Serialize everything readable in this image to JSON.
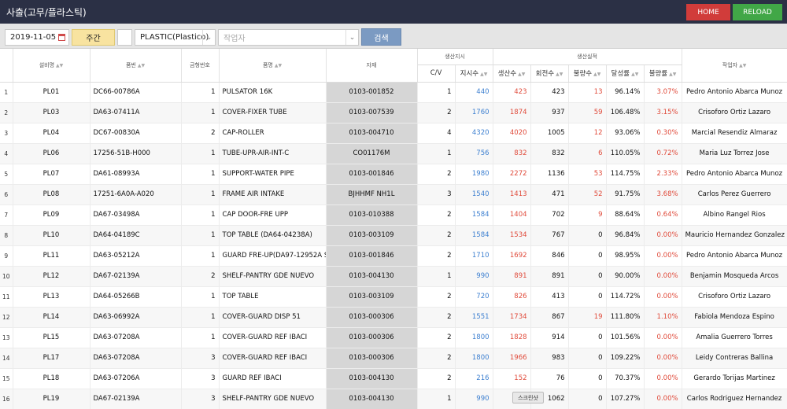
{
  "header": {
    "title": "사출(고무/플라스틱)",
    "home_label": "HOME",
    "reload_label": "RELOAD"
  },
  "toolbar": {
    "date": "2019-11-05",
    "week_label": "주간",
    "plastic_select": "PLASTIC(Plastico)",
    "worker_placeholder": "작업자",
    "search_label": "검색"
  },
  "table": {
    "group_headers": {
      "plan": "생산지시",
      "actual": "생산실적"
    },
    "columns": {
      "equip": "설비명",
      "part": "품번",
      "mold": "금형번호",
      "name": "품명",
      "material": "자재",
      "cv": "C/V",
      "order": "지시수",
      "prod": "생산수",
      "shots": "회전수",
      "defect": "불량수",
      "achieve": "달성률",
      "defect_rate": "불량률",
      "worker": "작업자"
    },
    "rows": [
      {
        "no": "1",
        "equip": "PL01",
        "part": "DC66-00786A",
        "mold": "1",
        "name": "PULSATOR 16K",
        "material": "0103-001852",
        "cv": "1",
        "order": "440",
        "prod": "423",
        "shots": "423",
        "defect": "13",
        "achieve": "96.14%",
        "defect_rate": "3.07%",
        "worker": "Pedro Antonio Abarca Munoz"
      },
      {
        "no": "2",
        "equip": "PL03",
        "part": "DA63-07411A",
        "mold": "1",
        "name": "COVER-FIXER TUBE",
        "material": "0103-007539",
        "cv": "2",
        "order": "1760",
        "prod": "1874",
        "shots": "937",
        "defect": "59",
        "achieve": "106.48%",
        "defect_rate": "3.15%",
        "worker": "Crisoforo Ortiz Lazaro"
      },
      {
        "no": "3",
        "equip": "PL04",
        "part": "DC67-00830A",
        "mold": "2",
        "name": "CAP-ROLLER",
        "material": "0103-004710",
        "cv": "4",
        "order": "4320",
        "prod": "4020",
        "shots": "1005",
        "defect": "12",
        "achieve": "93.06%",
        "defect_rate": "0.30%",
        "worker": "Marcial Resendiz Almaraz"
      },
      {
        "no": "4",
        "equip": "PL06",
        "part": "17256-51B-H000",
        "mold": "1",
        "name": "TUBE-UPR-AIR-INT-C",
        "material": "CO01176M",
        "cv": "1",
        "order": "756",
        "prod": "832",
        "shots": "832",
        "defect": "6",
        "achieve": "110.05%",
        "defect_rate": "0.72%",
        "worker": "Maria Luz Torrez Jose"
      },
      {
        "no": "5",
        "equip": "PL07",
        "part": "DA61-08993A",
        "mold": "1",
        "name": "SUPPORT-WATER PIPE",
        "material": "0103-001846",
        "cv": "2",
        "order": "1980",
        "prod": "2272",
        "shots": "1136",
        "defect": "53",
        "achieve": "114.75%",
        "defect_rate": "2.33%",
        "worker": "Pedro Antonio Abarca Munoz"
      },
      {
        "no": "6",
        "equip": "PL08",
        "part": "17251-6A0A-A020",
        "mold": "1",
        "name": "FRAME AIR INTAKE",
        "material": "BJHHMF NH1L",
        "cv": "3",
        "order": "1540",
        "prod": "1413",
        "shots": "471",
        "defect": "52",
        "achieve": "91.75%",
        "defect_rate": "3.68%",
        "worker": "Carlos Perez Guerrero"
      },
      {
        "no": "7",
        "equip": "PL09",
        "part": "DA67-03498A",
        "mold": "1",
        "name": "CAP DOOR-FRE UPP",
        "material": "0103-010388",
        "cv": "2",
        "order": "1584",
        "prod": "1404",
        "shots": "702",
        "defect": "9",
        "achieve": "88.64%",
        "defect_rate": "0.64%",
        "worker": "Albino Rangel Rios"
      },
      {
        "no": "8",
        "equip": "PL10",
        "part": "DA64-04189C",
        "mold": "1",
        "name": "TOP TABLE (DA64-04238A)",
        "material": "0103-003109",
        "cv": "2",
        "order": "1584",
        "prod": "1534",
        "shots": "767",
        "defect": "0",
        "achieve": "96.84%",
        "defect_rate": "0.00%",
        "worker": "Mauricio Hernandez Gonzalez"
      },
      {
        "no": "9",
        "equip": "PL11",
        "part": "DA63-05212A",
        "mold": "1",
        "name": "GUARD FRE-UP(DA97-12952A S/SE",
        "material": "0103-001846",
        "cv": "2",
        "order": "1710",
        "prod": "1692",
        "shots": "846",
        "defect": "0",
        "achieve": "98.95%",
        "defect_rate": "0.00%",
        "worker": "Pedro Antonio Abarca Munoz"
      },
      {
        "no": "10",
        "equip": "PL12",
        "part": "DA67-02139A",
        "mold": "2",
        "name": "SHELF-PANTRY GDE NUEVO",
        "material": "0103-004130",
        "cv": "1",
        "order": "990",
        "prod": "891",
        "shots": "891",
        "defect": "0",
        "achieve": "90.00%",
        "defect_rate": "0.00%",
        "worker": "Benjamin Mosqueda Arcos"
      },
      {
        "no": "11",
        "equip": "PL13",
        "part": "DA64-05266B",
        "mold": "1",
        "name": "TOP TABLE",
        "material": "0103-003109",
        "cv": "2",
        "order": "720",
        "prod": "826",
        "shots": "413",
        "defect": "0",
        "achieve": "114.72%",
        "defect_rate": "0.00%",
        "worker": "Crisoforo Ortiz Lazaro"
      },
      {
        "no": "12",
        "equip": "PL14",
        "part": "DA63-06992A",
        "mold": "1",
        "name": "COVER-GUARD DISP 51",
        "material": "0103-000306",
        "cv": "2",
        "order": "1551",
        "prod": "1734",
        "shots": "867",
        "defect": "19",
        "achieve": "111.80%",
        "defect_rate": "1.10%",
        "worker": "Fabiola Mendoza Espino"
      },
      {
        "no": "13",
        "equip": "PL15",
        "part": "DA63-07208A",
        "mold": "1",
        "name": "COVER-GUARD REF IBACI",
        "material": "0103-000306",
        "cv": "2",
        "order": "1800",
        "prod": "1828",
        "shots": "914",
        "defect": "0",
        "achieve": "101.56%",
        "defect_rate": "0.00%",
        "worker": "Amalia Guerrero Torres"
      },
      {
        "no": "14",
        "equip": "PL17",
        "part": "DA63-07208A",
        "mold": "3",
        "name": "COVER-GUARD REF IBACI",
        "material": "0103-000306",
        "cv": "2",
        "order": "1800",
        "prod": "1966",
        "shots": "983",
        "defect": "0",
        "achieve": "109.22%",
        "defect_rate": "0.00%",
        "worker": "Leidy Contreras Ballina"
      },
      {
        "no": "15",
        "equip": "PL18",
        "part": "DA63-07206A",
        "mold": "3",
        "name": "GUARD REF IBACI",
        "material": "0103-004130",
        "cv": "2",
        "order": "216",
        "prod": "152",
        "shots": "76",
        "defect": "0",
        "achieve": "70.37%",
        "defect_rate": "0.00%",
        "worker": "Gerardo Torijas Martinez"
      },
      {
        "no": "16",
        "equip": "PL19",
        "part": "DA67-02139A",
        "mold": "3",
        "name": "SHELF-PANTRY GDE NUEVO",
        "material": "0103-004130",
        "cv": "1",
        "order": "990",
        "prod": "",
        "shots": "1062",
        "defect": "0",
        "achieve": "107.27%",
        "defect_rate": "0.00%",
        "worker": "Carlos Rodriguez Hernandez"
      }
    ]
  },
  "tooltip": "스크린샷",
  "colors": {
    "header_bg": "#2b3045",
    "home": "#d13c3a",
    "reload": "#41a747",
    "accent_blue": "#3c7fd0",
    "accent_red": "#e04a3a"
  }
}
